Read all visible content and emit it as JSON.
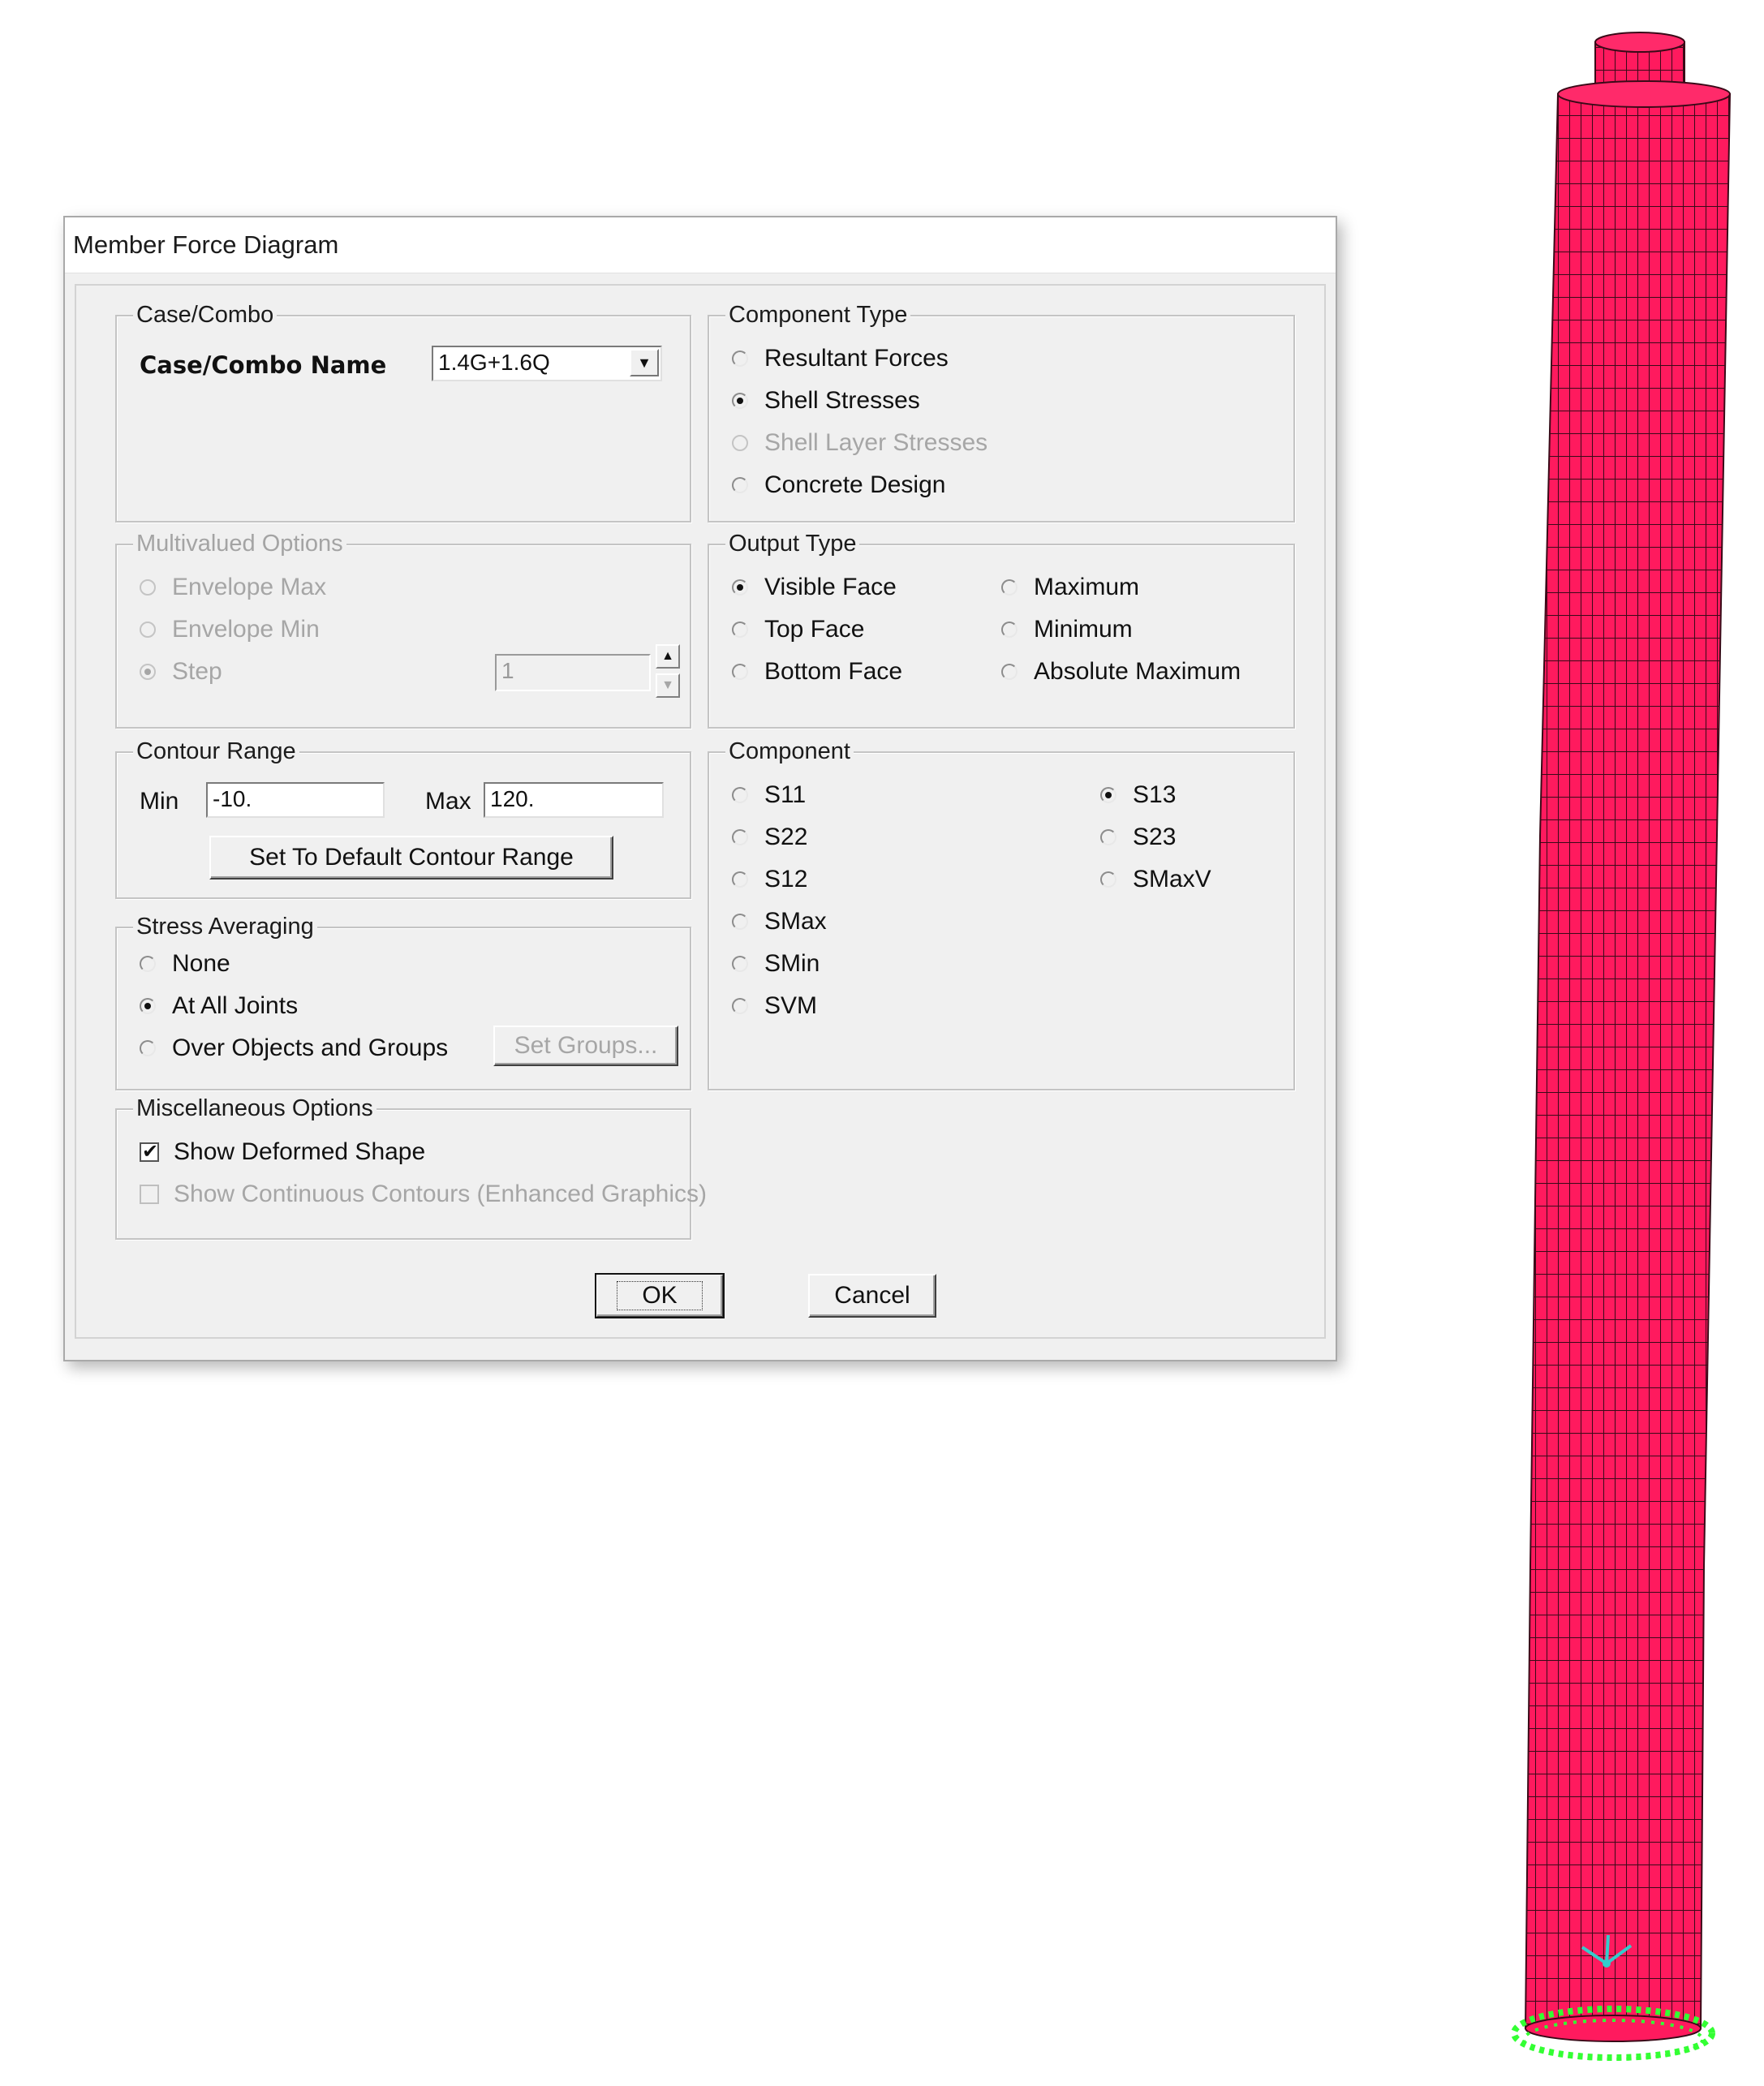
{
  "dialog": {
    "title": "Member Force Diagram",
    "case_combo": {
      "legend": "Case/Combo",
      "name_label": "Case/Combo Name",
      "value": "1.4G+1.6Q"
    },
    "multivalued": {
      "legend": "Multivalued Options",
      "options": [
        "Envelope Max",
        "Envelope Min",
        "Step"
      ],
      "selected": "Step",
      "step_value": "1"
    },
    "contour_range": {
      "legend": "Contour Range",
      "min_label": "Min",
      "min_value": "-10.",
      "max_label": "Max",
      "max_value": "120.",
      "default_button": "Set To Default Contour Range"
    },
    "stress_averaging": {
      "legend": "Stress Averaging",
      "options": [
        "None",
        "At All Joints",
        "Over Objects and Groups"
      ],
      "selected": "At All Joints",
      "set_groups_button": "Set Groups..."
    },
    "misc": {
      "legend": "Miscellaneous Options",
      "show_deformed": "Show Deformed Shape",
      "show_deformed_checked": true,
      "show_continuous": "Show Continuous Contours  (Enhanced Graphics)",
      "show_continuous_checked": false
    },
    "component_type": {
      "legend": "Component Type",
      "options": [
        "Resultant Forces",
        "Shell Stresses",
        "Shell Layer Stresses",
        "Concrete Design"
      ],
      "selected": "Shell Stresses"
    },
    "output_type": {
      "legend": "Output Type",
      "options": [
        "Visible Face",
        "Top Face",
        "Bottom Face",
        "Maximum",
        "Minimum",
        "Absolute Maximum"
      ],
      "selected": "Visible Face"
    },
    "component": {
      "legend": "Component",
      "options": [
        "S11",
        "S22",
        "S12",
        "SMax",
        "SMin",
        "SVM",
        "S13",
        "S23",
        "SMaxV"
      ],
      "selected": "S13"
    },
    "ok_button": "OK",
    "cancel_button": "Cancel"
  },
  "model_view": {
    "shell_color": "#ff1a5e",
    "mesh_line_color": "#3a0a18",
    "support_color": "#33ff33",
    "axis_color": "#33cccc"
  }
}
